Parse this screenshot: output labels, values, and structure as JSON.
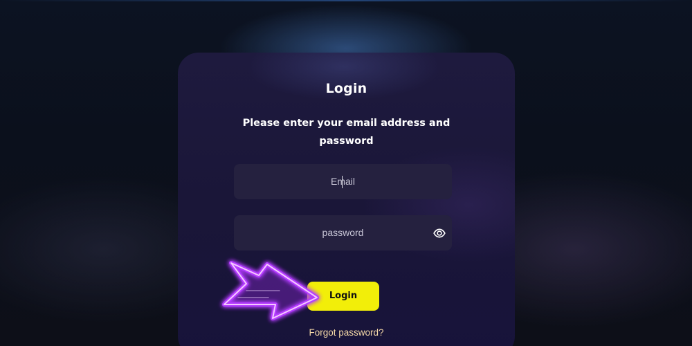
{
  "login": {
    "title": "Login",
    "subtitle": "Please enter your email address and password",
    "email_placeholder": "Email",
    "password_placeholder": "password",
    "password_toggle_icon": "eye-icon",
    "login_button": "Login",
    "forgot_link": "Forgot password?"
  },
  "overlay": {
    "arrow_icon": "neon-arrow-icon",
    "arrow_color": "#c23cff"
  },
  "colors": {
    "button_bg": "#f2ee09",
    "card_bg": "#1e1a3e",
    "link": "#f5d9a8"
  }
}
